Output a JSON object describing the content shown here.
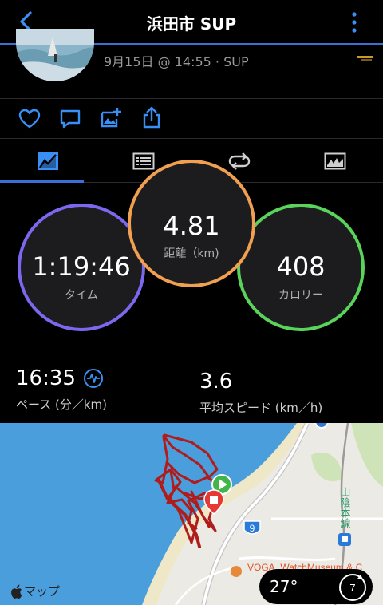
{
  "header": {
    "title": "浜田市 SUP"
  },
  "activity": {
    "meta": "9月15日 @ 14:55 · SUP"
  },
  "tabs": [
    {
      "id": "overview",
      "icon": "overview-icon"
    },
    {
      "id": "laps",
      "icon": "list-icon"
    },
    {
      "id": "repeat",
      "icon": "repeat-icon"
    },
    {
      "id": "charts",
      "icon": "chart-icon"
    }
  ],
  "rings": {
    "time": {
      "value": "1:19:46",
      "label": "タイム",
      "color": "#7b68ee"
    },
    "distance": {
      "value": "4.81",
      "label": "距離（km)",
      "color": "#f0a050"
    },
    "calories": {
      "value": "408",
      "label": "カロリー",
      "color": "#5ad35a"
    }
  },
  "stats": {
    "pace": {
      "value": "16:35",
      "label": "ペース (分／km)"
    },
    "speed": {
      "value": "3.6",
      "label": "平均スピード (km／h)"
    }
  },
  "map": {
    "road_number": "9",
    "railway_label": "山陰本線",
    "poi_label": "VOGA_WatchMuseum & C",
    "attribution": "マップ",
    "temperature": "27°",
    "wind": "7",
    "colors": {
      "sea": "#4a9edb",
      "land": "#eceae4",
      "route": "#b01c1c"
    }
  }
}
